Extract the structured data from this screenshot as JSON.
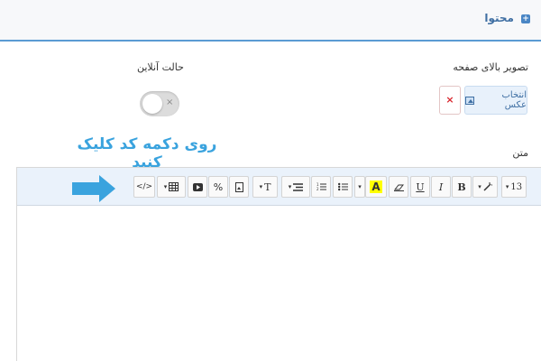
{
  "header": {
    "title": "محتوا",
    "icon": "expand-icon"
  },
  "fields": {
    "header_image_label": "تصویر بالای صفحه",
    "online_mode_label": "حالت آنلاین",
    "text_label": "متن"
  },
  "image_picker": {
    "select_label": "انتخاب عکس",
    "remove_label": "×"
  },
  "toggle": {
    "state": "off",
    "off_symbol": "×"
  },
  "annotation": {
    "text": "روی دکمه کد کلیک کنید",
    "color": "#3aa3de"
  },
  "toolbar": {
    "code_label": "</>",
    "link_symbol": "%",
    "font_size_label": "13",
    "bold_label": "B",
    "italic_label": "I",
    "underline_label": "U",
    "highlight_label": "A",
    "text_style_label": "T",
    "caret": "▾"
  },
  "colors": {
    "accent": "#5a9bd3",
    "toolbar_bg": "#eaf2fb",
    "remove_red": "#d9272e"
  }
}
